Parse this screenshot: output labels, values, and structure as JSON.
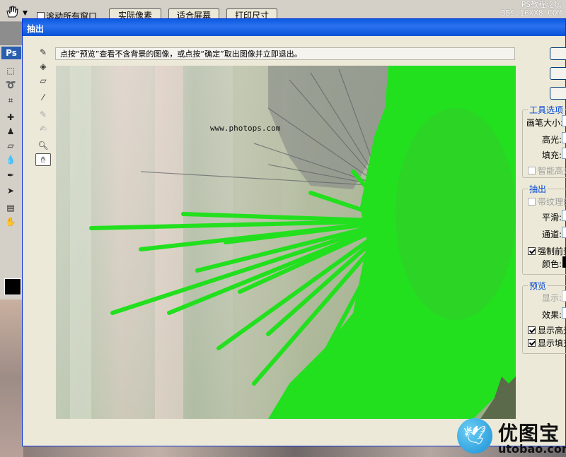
{
  "topbar": {
    "checkbox_label": "滚动所有窗口",
    "btn_actual": "实际像素",
    "btn_fit": "适合屏幕",
    "btn_print": "打印尺寸",
    "watermark_line1": "PS教程论坛",
    "watermark_line2": "BBS.16XX8.COM"
  },
  "ps": {
    "logo": "Ps"
  },
  "dialog": {
    "title": "抽出",
    "instruction": "点按“预览”查看不含背景的图像，或点按“确定”取出图像并立即退出。",
    "canvas_text": "www.photops.com"
  },
  "tool_options": {
    "group_label": "工具选项",
    "brush_size": "画笔大小:",
    "highlight": "高光:",
    "fill": "填充:",
    "smart_highlight": "智能高光"
  },
  "extract": {
    "group_label": "抽出",
    "textured": "带纹理的",
    "smooth": "平滑:",
    "channel": "通道:",
    "force_fg": "强制前景",
    "color": "颜色:"
  },
  "preview": {
    "group_label": "预览",
    "show": "显示:",
    "effect": "效果:",
    "show_highlight": "显示高光",
    "show_fill": "显示填充"
  },
  "logo": {
    "cn": "优图宝",
    "en": "utobao.com"
  },
  "colors": {
    "highlight_green": "#22e01e",
    "titlebar_blue": "#0a5ade"
  },
  "icons": [
    "hand-icon",
    "edge-highlighter-icon",
    "fill-icon",
    "eraser-icon",
    "eyedropper-icon",
    "cleanup-icon",
    "edge-touchup-icon",
    "zoom-icon"
  ]
}
